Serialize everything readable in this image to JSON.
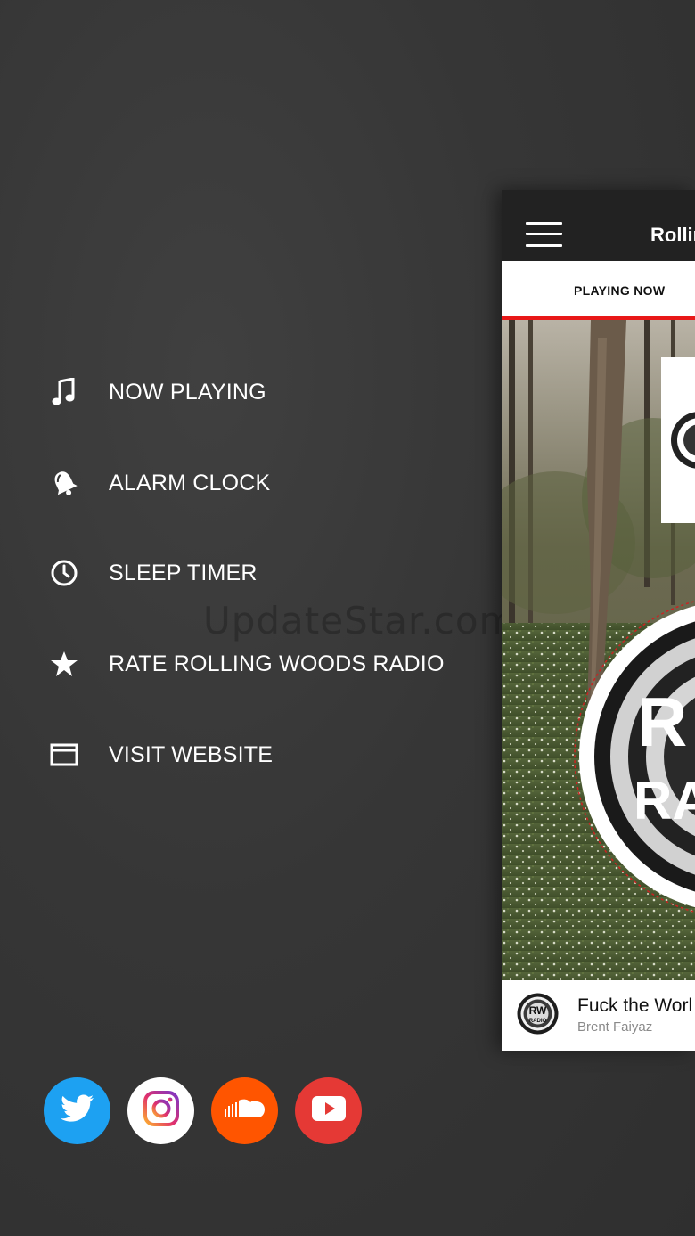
{
  "menu": {
    "items": [
      {
        "label": "NOW PLAYING",
        "icon": "music-note-icon"
      },
      {
        "label": "ALARM CLOCK",
        "icon": "bell-icon"
      },
      {
        "label": "SLEEP TIMER",
        "icon": "clock-icon"
      },
      {
        "label": "RATE ROLLING WOODS RADIO",
        "icon": "star-icon"
      },
      {
        "label": "VISIT WEBSITE",
        "icon": "browser-window-icon"
      }
    ]
  },
  "watermark": "UpdateStar.com",
  "social": [
    {
      "name": "twitter",
      "icon": "twitter-icon",
      "color": "#1da1f2"
    },
    {
      "name": "instagram",
      "icon": "instagram-icon",
      "color": "#ffffff"
    },
    {
      "name": "soundcloud",
      "icon": "soundcloud-icon",
      "color": "#ff5500"
    },
    {
      "name": "youtube",
      "icon": "youtube-icon",
      "color": "#e53935"
    }
  ],
  "preview": {
    "app_title": "Rollin",
    "tab_label": "PLAYING NOW",
    "now_playing": {
      "title": "Fuck the Worl",
      "artist": "Brent Faiyaz",
      "thumb_text": "RW RADIO"
    }
  },
  "colors": {
    "background": "#363636",
    "accent": "#e81818",
    "topbar": "#222222"
  }
}
